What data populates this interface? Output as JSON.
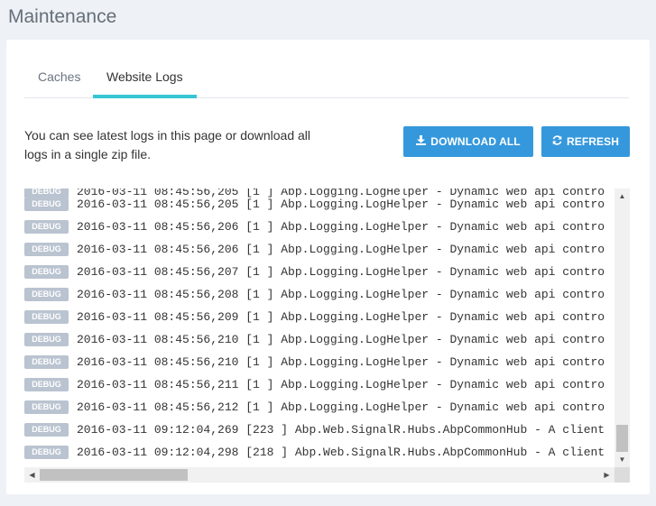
{
  "page": {
    "title": "Maintenance"
  },
  "tabs": [
    {
      "label": "Caches",
      "active": false
    },
    {
      "label": "Website Logs",
      "active": true
    }
  ],
  "description": "You can see latest logs in this page or download all logs in a single zip file.",
  "buttons": {
    "download_all": {
      "label": "DOWNLOAD ALL",
      "icon": "download-icon"
    },
    "refresh": {
      "label": "REFRESH",
      "icon": "refresh-icon"
    }
  },
  "colors": {
    "primary_button": "#3598dc",
    "active_tab_accent": "#36c6d3",
    "debug_badge": "#bac3d0"
  },
  "logs": [
    {
      "level": "DEBUG",
      "text": "2016-03-11 08:45:56,205 [1 ] Abp.Logging.LogHelper - Dynamic web api contro"
    },
    {
      "level": "DEBUG",
      "text": "2016-03-11 08:45:56,206 [1 ] Abp.Logging.LogHelper - Dynamic web api contro"
    },
    {
      "level": "DEBUG",
      "text": "2016-03-11 08:45:56,206 [1 ] Abp.Logging.LogHelper - Dynamic web api contro"
    },
    {
      "level": "DEBUG",
      "text": "2016-03-11 08:45:56,207 [1 ] Abp.Logging.LogHelper - Dynamic web api contro"
    },
    {
      "level": "DEBUG",
      "text": "2016-03-11 08:45:56,208 [1 ] Abp.Logging.LogHelper - Dynamic web api contro"
    },
    {
      "level": "DEBUG",
      "text": "2016-03-11 08:45:56,209 [1 ] Abp.Logging.LogHelper - Dynamic web api contro"
    },
    {
      "level": "DEBUG",
      "text": "2016-03-11 08:45:56,210 [1 ] Abp.Logging.LogHelper - Dynamic web api contro"
    },
    {
      "level": "DEBUG",
      "text": "2016-03-11 08:45:56,210 [1 ] Abp.Logging.LogHelper - Dynamic web api contro"
    },
    {
      "level": "DEBUG",
      "text": "2016-03-11 08:45:56,211 [1 ] Abp.Logging.LogHelper - Dynamic web api contro"
    },
    {
      "level": "DEBUG",
      "text": "2016-03-11 08:45:56,212 [1 ] Abp.Logging.LogHelper - Dynamic web api contro"
    },
    {
      "level": "DEBUG",
      "text": "2016-03-11 09:12:04,269 [223 ] Abp.Web.SignalR.Hubs.AbpCommonHub - A client"
    },
    {
      "level": "DEBUG",
      "text": "2016-03-11 09:12:04,298 [218 ] Abp.Web.SignalR.Hubs.AbpCommonHub - A client"
    }
  ]
}
